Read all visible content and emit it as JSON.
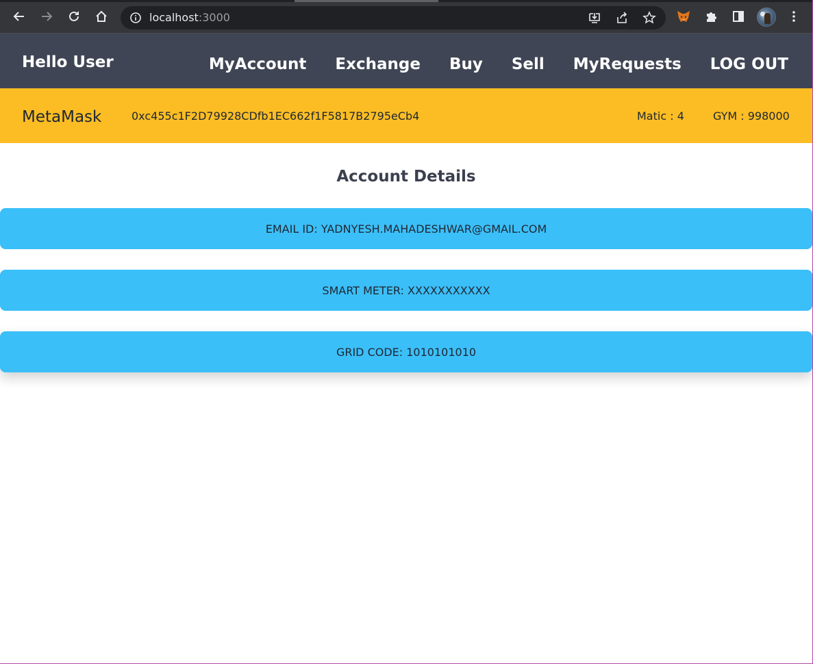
{
  "browser": {
    "url_host": "localhost",
    "url_port": ":3000"
  },
  "navbar": {
    "brand": "Hello User",
    "links": [
      "MyAccount",
      "Exchange",
      "Buy",
      "Sell",
      "MyRequests",
      "LOG OUT"
    ]
  },
  "wallet": {
    "name": "MetaMask",
    "address": "0xc455c1F2D79928CDfb1EC662f1F5817B2795eCb4",
    "matic": "Matic : 4",
    "gym": "GYM : 998000"
  },
  "account": {
    "title": "Account Details",
    "fields": [
      "EMAIL ID: YADNYESH.MAHADESHWAR@GMAIL.COM",
      "SMART METER: XXXXXXXXXXX",
      "GRID CODE: 1010101010"
    ]
  },
  "colors": {
    "navbar_bg": "#3f4554",
    "wallet_bg": "#fbbd23",
    "card_bg": "#3bbff8",
    "text_dark": "#1f2733"
  }
}
